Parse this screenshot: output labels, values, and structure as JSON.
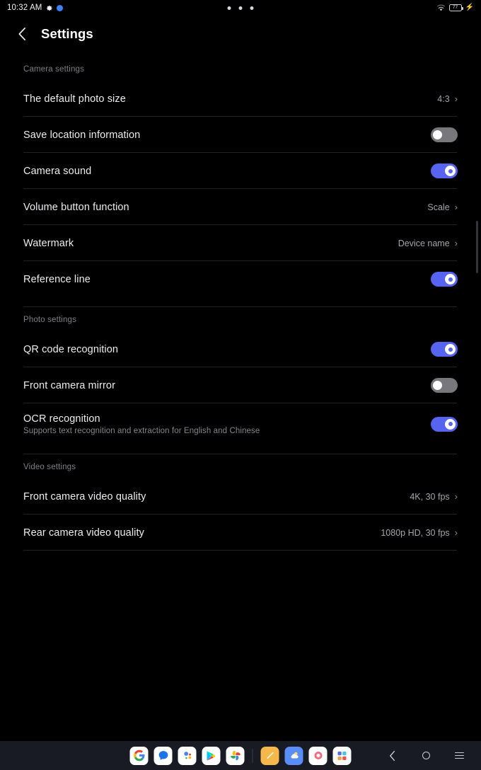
{
  "status_bar": {
    "time": "10:32 AM",
    "icons_left": [
      "gear-icon",
      "blue-dot-icon"
    ],
    "camera_dots": 3,
    "wifi_icon": "wifi-icon",
    "battery_percent": "77",
    "charging_icon": "charging-bolt-icon"
  },
  "header": {
    "back_icon": "back-chevron-icon",
    "title": "Settings"
  },
  "sections": [
    {
      "label": "Camera settings",
      "rows": [
        {
          "title": "The default photo size",
          "value": "4:3",
          "control": "chevron"
        },
        {
          "title": "Save location information",
          "control": "toggle",
          "state": "off"
        },
        {
          "title": "Camera sound",
          "control": "toggle",
          "state": "on"
        },
        {
          "title": "Volume button function",
          "value": "Scale",
          "control": "chevron"
        },
        {
          "title": "Watermark",
          "value": "Device name",
          "control": "chevron"
        },
        {
          "title": "Reference line",
          "control": "toggle",
          "state": "on"
        }
      ]
    },
    {
      "label": "Photo settings",
      "rows": [
        {
          "title": "QR code recognition",
          "control": "toggle",
          "state": "on"
        },
        {
          "title": "Front camera mirror",
          "control": "toggle",
          "state": "off"
        },
        {
          "title": "OCR recognition",
          "subtitle": "Supports text recognition and extraction for English and Chinese",
          "control": "toggle",
          "state": "on"
        }
      ]
    },
    {
      "label": "Video settings",
      "rows": [
        {
          "title": "Front camera video quality",
          "value": "4K, 30 fps",
          "control": "chevron"
        },
        {
          "title": "Rear camera video quality",
          "value": "1080p HD, 30 fps",
          "control": "chevron"
        }
      ]
    }
  ],
  "dock": {
    "apps": [
      {
        "name": "google-search-icon",
        "label": "Google"
      },
      {
        "name": "messages-icon",
        "label": "Messages"
      },
      {
        "name": "google-contacts-icon",
        "label": "Contacts"
      },
      {
        "name": "play-store-icon",
        "label": "Play Store"
      },
      {
        "name": "google-photos-icon",
        "label": "Photos"
      },
      {
        "name": "notes-icon",
        "label": "Notes"
      },
      {
        "name": "weather-icon",
        "label": "Weather"
      },
      {
        "name": "gallery-icon",
        "label": "Gallery"
      },
      {
        "name": "app-drawer-icon",
        "label": "Apps"
      }
    ],
    "nav": [
      {
        "name": "nav-back",
        "label": "Back"
      },
      {
        "name": "nav-home",
        "label": "Home"
      },
      {
        "name": "nav-recents",
        "label": "Recents"
      }
    ]
  },
  "colors": {
    "accent": "#5664f0",
    "background": "#000000",
    "dock_background": "#181b24",
    "divider": "#222226",
    "text_primary": "#ececee",
    "text_secondary": "#85858b"
  }
}
